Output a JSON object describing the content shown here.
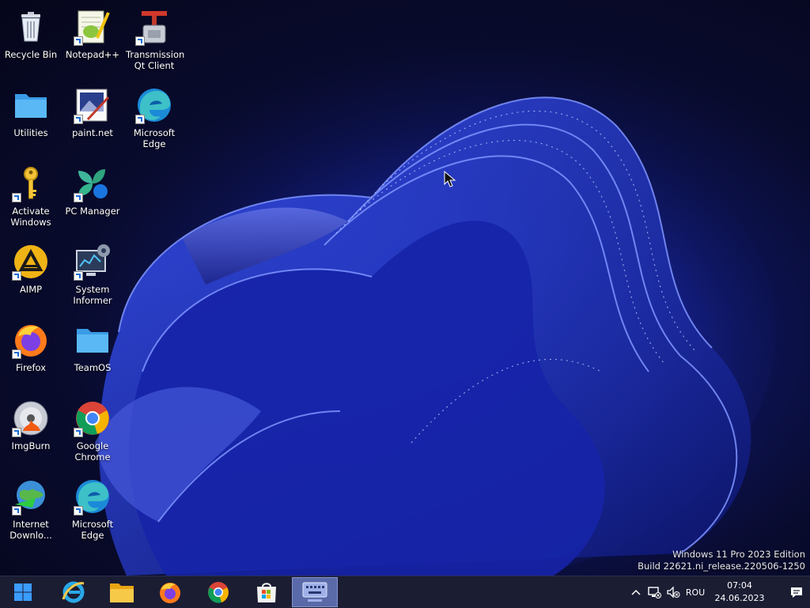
{
  "desktop": {
    "icons": [
      {
        "id": "recycle-bin",
        "label": "Recycle Bin"
      },
      {
        "id": "notepad-plus-plus",
        "label": "Notepad++"
      },
      {
        "id": "transmission",
        "label": "Transmission Qt Client"
      },
      {
        "id": "utilities",
        "label": "Utilities"
      },
      {
        "id": "paint-net",
        "label": "paint.net"
      },
      {
        "id": "microsoft-edge-1",
        "label": "Microsoft Edge"
      },
      {
        "id": "activate-windows",
        "label": "Activate Windows"
      },
      {
        "id": "pc-manager",
        "label": "PC Manager"
      },
      {
        "id": "aimp",
        "label": "AIMP"
      },
      {
        "id": "system-informer",
        "label": "System Informer"
      },
      {
        "id": "firefox",
        "label": "Firefox"
      },
      {
        "id": "teamos",
        "label": "TeamOS"
      },
      {
        "id": "imgburn",
        "label": "ImgBurn"
      },
      {
        "id": "google-chrome",
        "label": "Google Chrome"
      },
      {
        "id": "internet-download",
        "label": "Internet Downlo..."
      },
      {
        "id": "microsoft-edge-2",
        "label": "Microsoft Edge"
      }
    ]
  },
  "watermark": {
    "line1": "Windows 11 Pro 2023 Edition",
    "line2": "Build 22621.ni_release.220506-1250"
  },
  "taskbar": {
    "apps": [
      "start-icon",
      "internet-explorer-icon",
      "file-explorer-icon",
      "firefox-icon",
      "chrome-icon",
      "microsoft-store-icon",
      "touch-keyboard-icon"
    ],
    "tray": {
      "language": "ROU",
      "time": "07:04",
      "date": "24.06.2023"
    }
  },
  "colors": {
    "taskbar_bg": "#1b1d33",
    "active_app_bg": "#5a6aa8",
    "accent_blue": "#1c6bd6",
    "wallpaper_blue": "#2438c8"
  }
}
